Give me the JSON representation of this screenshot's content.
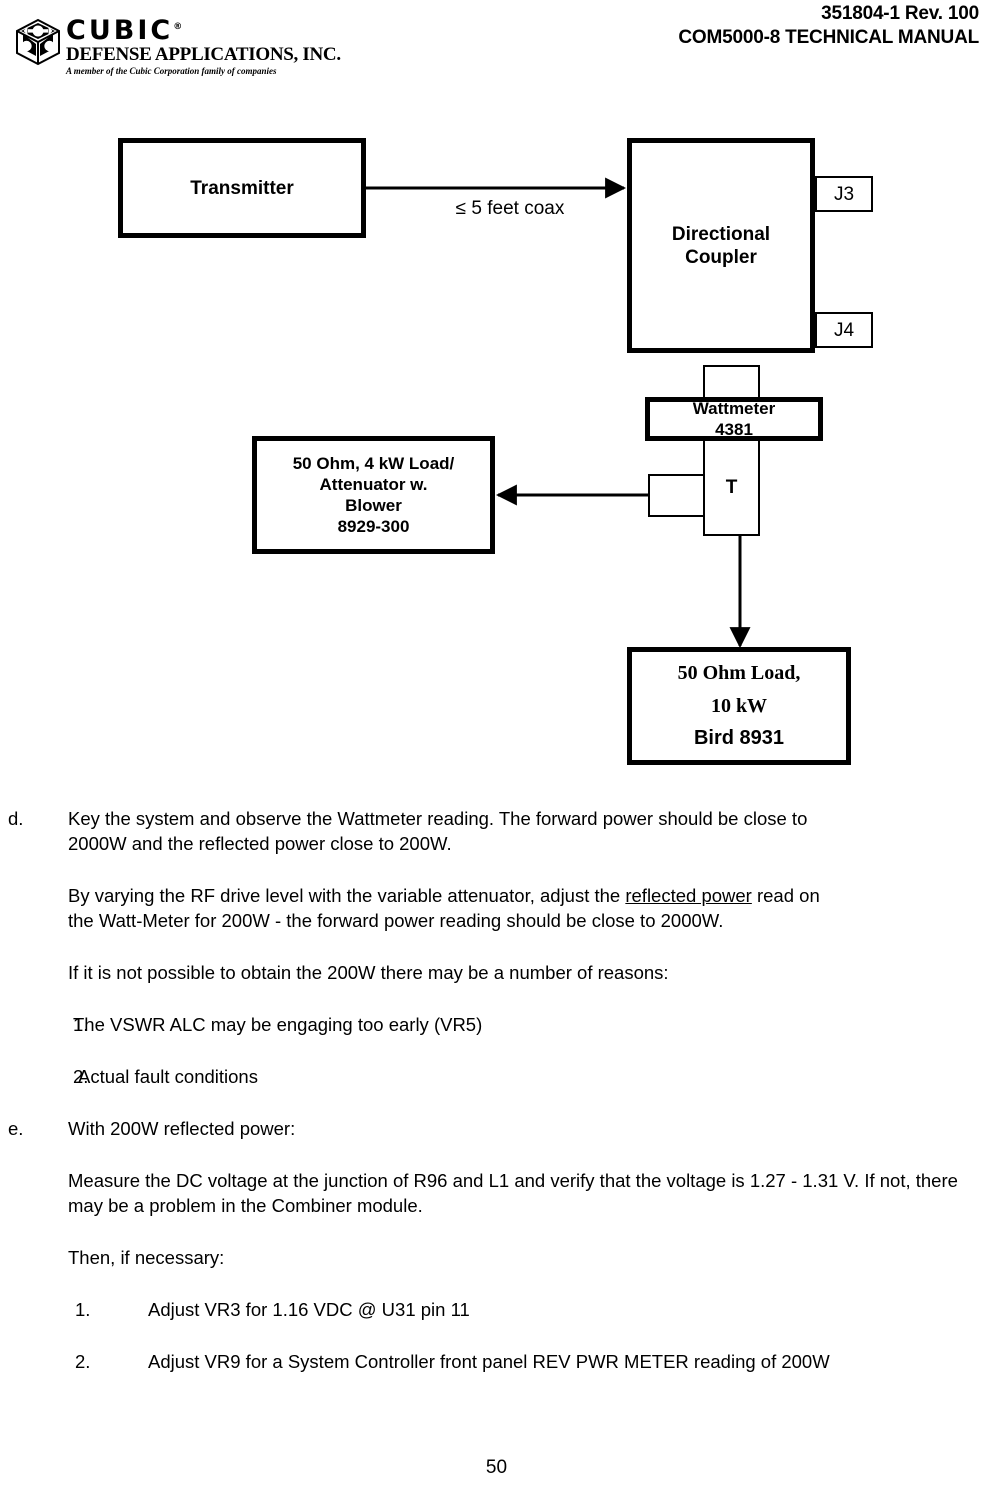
{
  "header": {
    "doc_number": "351804-1 Rev. 100",
    "manual_title": "COM5000-8 TECHNICAL MANUAL"
  },
  "logo": {
    "name": "CUBIC",
    "division": "DEFENSE APPLICATIONS, INC.",
    "tagline": "A member of the Cubic Corporation family of companies",
    "registered_mark": "®"
  },
  "diagram": {
    "transmitter": "Transmitter",
    "coax_label": "≤ 5 feet coax",
    "coupler_line1": "Directional",
    "coupler_line2": "Coupler",
    "j3": "J3",
    "j4": "J4",
    "wattmeter_line1": "Wattmeter",
    "wattmeter_line2": "4381",
    "tee": "T",
    "load_attenuator_line1": "50 Ohm, 4 kW Load/",
    "load_attenuator_line2": "Attenuator w.",
    "load_attenuator_line3": "Blower",
    "load_attenuator_line4": "8929-300",
    "dummy_load_line1": "50 Ohm Load,",
    "dummy_load_line2": "10 kW",
    "dummy_load_line3": "Bird 8931"
  },
  "body": {
    "item_d_marker": "d.",
    "item_d_text": "Key the system and observe the Wattmeter reading. The forward power should be close to 2000W and the reflected power close to 200W.",
    "para_vary_pre": "By varying the RF drive level with the variable attenuator, adjust the ",
    "para_vary_underlined": "reflected power",
    "para_vary_post": " read on the Watt-Meter for 200W - the forward power reading should be close to 2000W.",
    "para_reasons": "If it is not possible to obtain the 200W there may be a number of reasons:",
    "reason_1_marker": "1.",
    "reason_1_text": "The VSWR ALC may be engaging too early (VR5)",
    "reason_2_marker": "2.",
    "reason_2_text": "Actual fault conditions",
    "item_e_marker": "e.",
    "item_e_text": "With 200W reflected power:",
    "para_measure": "Measure the DC voltage at the junction of R96 and L1 and verify that the voltage is 1.27 - 1.31 V. If not, there may be a problem in the Combiner module.",
    "para_then": "Then, if necessary:",
    "step_1_marker": "1.",
    "step_1_text": "Adjust VR3 for 1.16 VDC @ U31 pin 11",
    "step_2_marker": "2.",
    "step_2_text": "Adjust VR9 for a System Controller front panel REV PWR METER reading of 200W"
  },
  "footer": {
    "page_number": "50"
  }
}
